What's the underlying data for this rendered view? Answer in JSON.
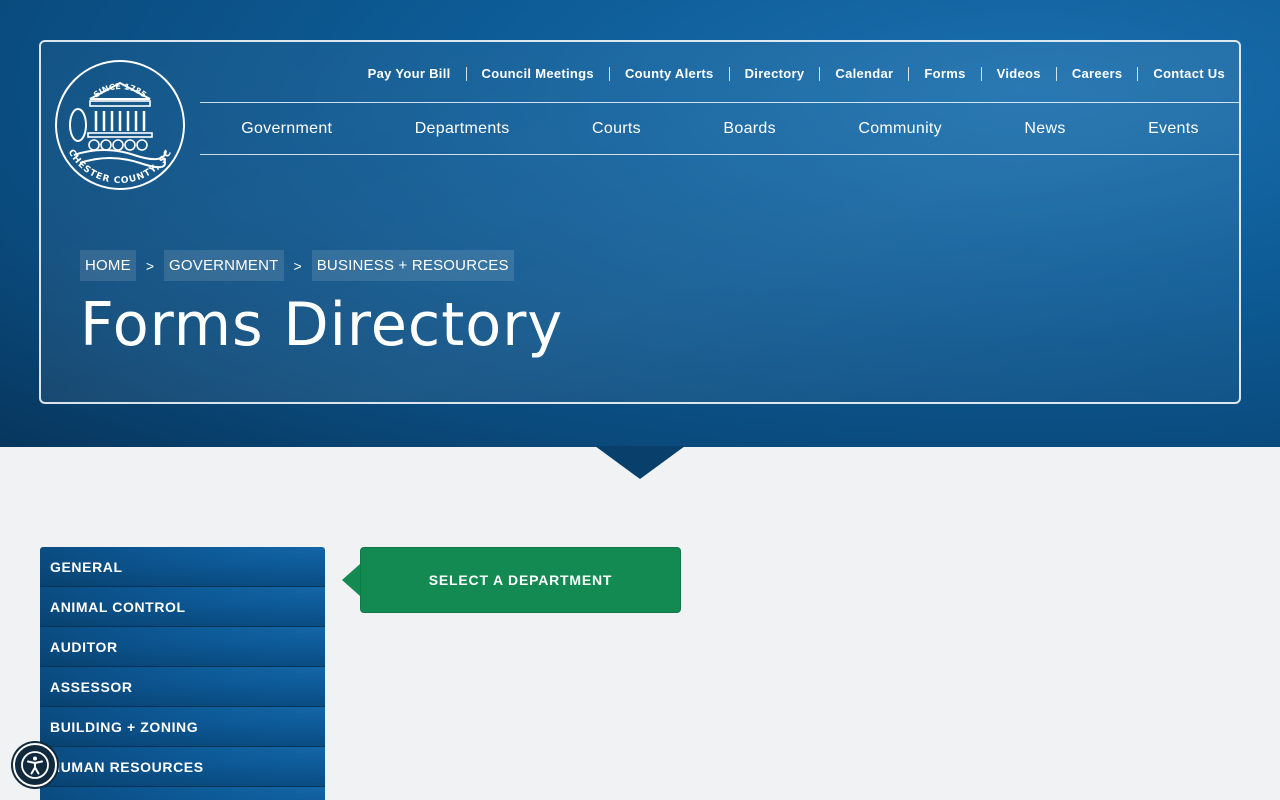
{
  "logo": {
    "top_text": "SINCE 1785",
    "bottom_text": "CHESTER COUNTY, SC"
  },
  "utility_nav": [
    {
      "label": "Pay Your Bill"
    },
    {
      "label": "Council Meetings"
    },
    {
      "label": "County Alerts"
    },
    {
      "label": "Directory"
    },
    {
      "label": "Calendar"
    },
    {
      "label": "Forms"
    },
    {
      "label": "Videos"
    },
    {
      "label": "Careers"
    },
    {
      "label": "Contact Us"
    }
  ],
  "main_nav": [
    {
      "label": "Government"
    },
    {
      "label": "Departments"
    },
    {
      "label": "Courts"
    },
    {
      "label": "Boards"
    },
    {
      "label": "Community"
    },
    {
      "label": "News"
    },
    {
      "label": "Events"
    }
  ],
  "breadcrumb": [
    {
      "label": "HOME"
    },
    {
      "label": "GOVERNMENT"
    },
    {
      "label": "BUSINESS + RESOURCES"
    }
  ],
  "breadcrumb_separator": ">",
  "page_title": "Forms Directory",
  "sidebar": [
    {
      "label": "GENERAL"
    },
    {
      "label": "ANIMAL CONTROL"
    },
    {
      "label": "AUDITOR"
    },
    {
      "label": "ASSESSOR"
    },
    {
      "label": "BUILDING + ZONING"
    },
    {
      "label": "HUMAN RESOURCES"
    },
    {
      "label": ""
    }
  ],
  "select_department_label": "SELECT A DEPARTMENT",
  "icons": {
    "accessibility": "accessibility-icon",
    "logo": "courthouse-seal-icon"
  },
  "colors": {
    "brand_blue": "#0d5b96",
    "accent_green": "#138a52",
    "page_background": "#f1f2f4"
  }
}
